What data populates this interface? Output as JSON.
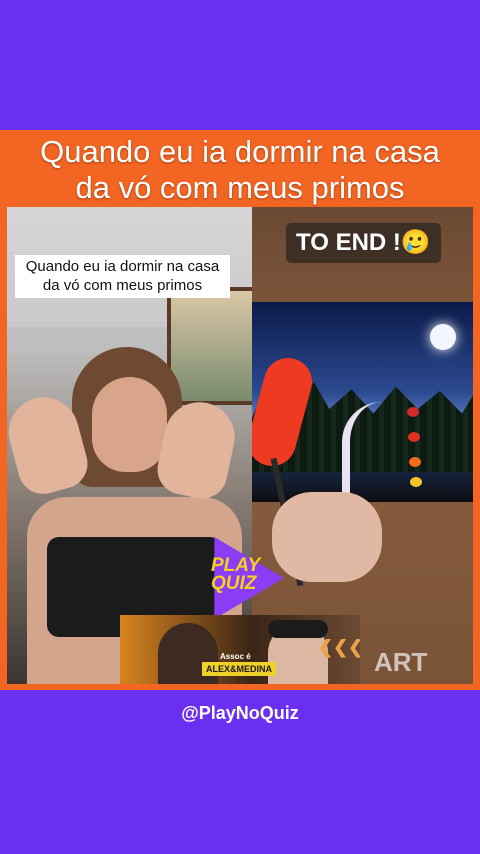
{
  "post": {
    "headline_line1": "Quando eu ia dormir na casa",
    "headline_line2": "da vó com meus primos",
    "handle": "@PlayNoQuiz"
  },
  "left_video": {
    "caption_line1": "Quando eu ia dormir na casa",
    "caption_line2": "da vó com meus primos"
  },
  "right_video": {
    "overlay_text": "TO END !",
    "emoji": "🥲",
    "watermark": "ART"
  },
  "logo": {
    "line1": "PLAY",
    "line2": "QUIZ"
  },
  "banner": {
    "small_text": "Assoc é",
    "name": "ALEX&MEDINA",
    "chevrons": "❮❮❮"
  },
  "colors": {
    "background": "#6a2ff0",
    "frame": "#f26522",
    "logo_purple": "#8b3cf5",
    "logo_yellow": "#f5d020"
  }
}
